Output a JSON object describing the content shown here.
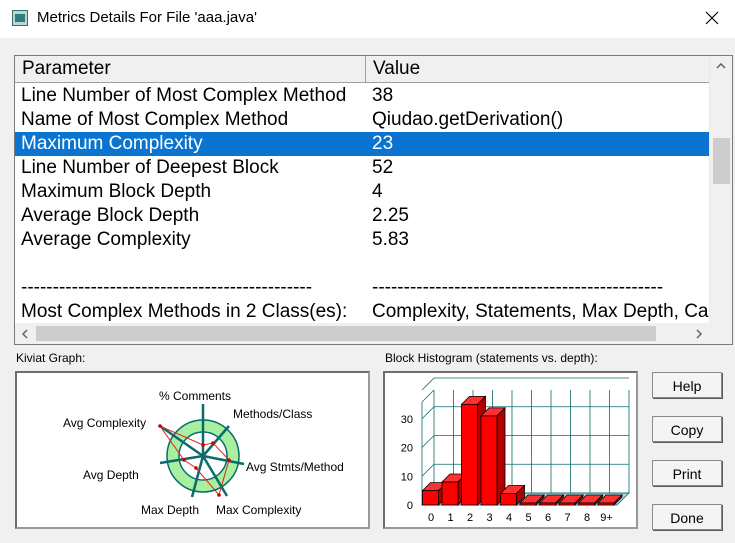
{
  "window": {
    "title": "Metrics Details For File 'aaa.java'"
  },
  "table": {
    "columns": [
      "Parameter",
      "Value"
    ],
    "rows": [
      {
        "param": "Line Number of Most Complex Method",
        "value": "38"
      },
      {
        "param": "Name of Most Complex Method",
        "value": "Qiudao.getDerivation()"
      },
      {
        "param": "Maximum Complexity",
        "value": "23",
        "selected": true
      },
      {
        "param": "Line Number of Deepest Block",
        "value": "52"
      },
      {
        "param": "Maximum Block Depth",
        "value": "4"
      },
      {
        "param": "Average Block Depth",
        "value": "2.25"
      },
      {
        "param": "Average Complexity",
        "value": "5.83"
      },
      {
        "param": "",
        "value": ""
      },
      {
        "param": "----------------------------------------------",
        "value": "----------------------------------------------"
      },
      {
        "param": "Most Complex Methods in 2 Class(es):",
        "value": "Complexity, Statements, Max Depth, Calls"
      }
    ]
  },
  "kiviat": {
    "label": "Kiviat Graph:",
    "axes": [
      "% Comments",
      "Methods/Class",
      "Avg Stmts/Method",
      "Max Complexity",
      "Max Depth",
      "Avg Depth",
      "Avg Complexity"
    ]
  },
  "histogram": {
    "label": "Block Histogram (statements vs. depth):",
    "chart_data": {
      "type": "bar",
      "categories": [
        "0",
        "1",
        "2",
        "3",
        "4",
        "5",
        "6",
        "7",
        "8",
        "9+"
      ],
      "values": [
        5,
        8,
        35,
        31,
        4,
        0,
        0,
        0,
        0,
        0
      ],
      "yticks": [
        "0",
        "10",
        "20",
        "30"
      ],
      "ylim": [
        0,
        40
      ],
      "bar_color": "#ff0000"
    }
  },
  "buttons": {
    "help": "Help",
    "copy": "Copy",
    "print": "Print",
    "done": "Done"
  },
  "colors": {
    "selection": "#0a74d0",
    "kiviat_ring": "#a8f0a0",
    "kiviat_axis": "#0b6b6b"
  }
}
